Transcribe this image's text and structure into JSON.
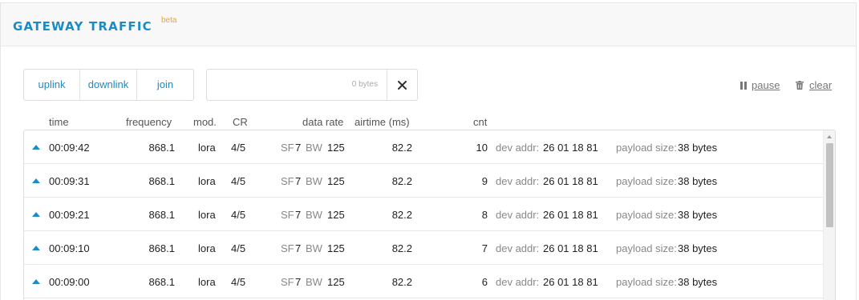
{
  "header": {
    "title": "GATEWAY TRAFFIC",
    "badge": "beta"
  },
  "filters": [
    {
      "label": "uplink"
    },
    {
      "label": "downlink"
    },
    {
      "label": "join"
    }
  ],
  "search": {
    "value": "",
    "bytes_label": "0 bytes"
  },
  "controls": {
    "pause_label": "pause",
    "clear_label": "clear"
  },
  "columns": {
    "time": "time",
    "frequency": "frequency",
    "mod": "mod.",
    "cr": "CR",
    "data_rate": "data rate",
    "airtime": "airtime (ms)",
    "cnt": "cnt"
  },
  "labels": {
    "sf": "SF",
    "bw": "BW",
    "dev_addr": "dev addr:",
    "payload_size": "payload size:"
  },
  "rows": [
    {
      "direction": "up",
      "time": "00:09:42",
      "frequency": "868.1",
      "mod": "lora",
      "cr": "4/5",
      "sf": "7",
      "bw": "125",
      "airtime": "82.2",
      "cnt": "10",
      "dev_addr": "26 01 18 81",
      "payload": "38 bytes"
    },
    {
      "direction": "up",
      "time": "00:09:31",
      "frequency": "868.1",
      "mod": "lora",
      "cr": "4/5",
      "sf": "7",
      "bw": "125",
      "airtime": "82.2",
      "cnt": "9",
      "dev_addr": "26 01 18 81",
      "payload": "38 bytes"
    },
    {
      "direction": "up",
      "time": "00:09:21",
      "frequency": "868.1",
      "mod": "lora",
      "cr": "4/5",
      "sf": "7",
      "bw": "125",
      "airtime": "82.2",
      "cnt": "8",
      "dev_addr": "26 01 18 81",
      "payload": "38 bytes"
    },
    {
      "direction": "up",
      "time": "00:09:10",
      "frequency": "868.1",
      "mod": "lora",
      "cr": "4/5",
      "sf": "7",
      "bw": "125",
      "airtime": "82.2",
      "cnt": "7",
      "dev_addr": "26 01 18 81",
      "payload": "38 bytes"
    },
    {
      "direction": "up",
      "time": "00:09:00",
      "frequency": "868.1",
      "mod": "lora",
      "cr": "4/5",
      "sf": "7",
      "bw": "125",
      "airtime": "82.2",
      "cnt": "6",
      "dev_addr": "26 01 18 81",
      "payload": "38 bytes"
    }
  ],
  "colors": {
    "accent": "#1a8cc8",
    "badge": "#f0a030"
  }
}
